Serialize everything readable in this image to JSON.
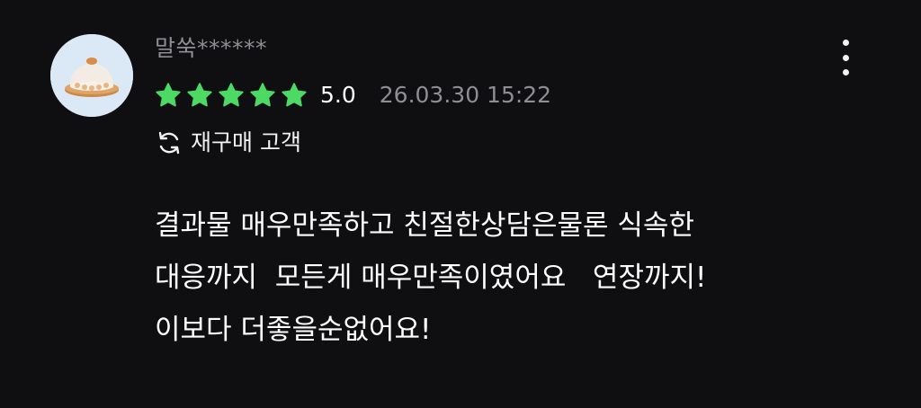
{
  "review": {
    "avatar_icon": "cake-avatar-icon",
    "username": "말쑥******",
    "more_icon": "more-vertical-icon",
    "rating": {
      "stars": 5,
      "max_stars": 5,
      "star_color": "#4cd964",
      "score": "5.0",
      "date": "26.03.30 15:22"
    },
    "repurchase": {
      "icon": "refresh-icon",
      "label": "재구매 고객"
    },
    "body_lines": [
      "결과물 매우만족하고 친절한상담은물론 식속한",
      "대응까지  모든게 매우만족이였어요   연장까지!",
      "이보다 더좋을순없어요!"
    ]
  }
}
